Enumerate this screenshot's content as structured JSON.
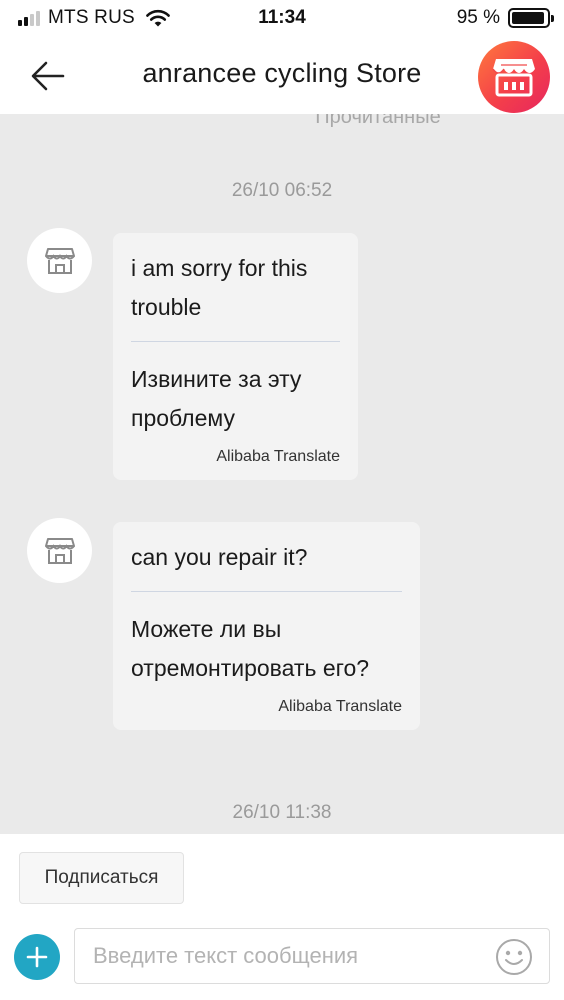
{
  "status_bar": {
    "carrier": "MTS RUS",
    "time": "11:34",
    "battery_percent": "95 %",
    "battery_level": 0.95,
    "signal_bars": 4,
    "signal_bars_active": 2
  },
  "header": {
    "title": "anrancee cycling Store",
    "back_icon": "arrow-left-icon",
    "store_icon": "storefront-icon",
    "store_gradient": [
      "#ff7a3d",
      "#e6265f"
    ]
  },
  "chat": {
    "read_status": "Прочитанные",
    "messages": [
      {
        "timestamp": "26/10 06:52",
        "original": "i am sorry for this trouble",
        "translation": "Извините за эту проблему",
        "credit": "Alibaba Translate"
      },
      {
        "timestamp": "",
        "original": "can you repair it?",
        "translation": "Можете ли вы отремонтировать его?",
        "credit": "Alibaba Translate"
      }
    ],
    "last_timestamp": "26/10 11:38"
  },
  "footer": {
    "subscribe_label": "Подписаться",
    "input_placeholder": "Введите текст сообщения",
    "input_value": "",
    "plus_icon": "plus-icon",
    "emoji_icon": "smiley-icon",
    "accent_color": "#22a6c4"
  }
}
